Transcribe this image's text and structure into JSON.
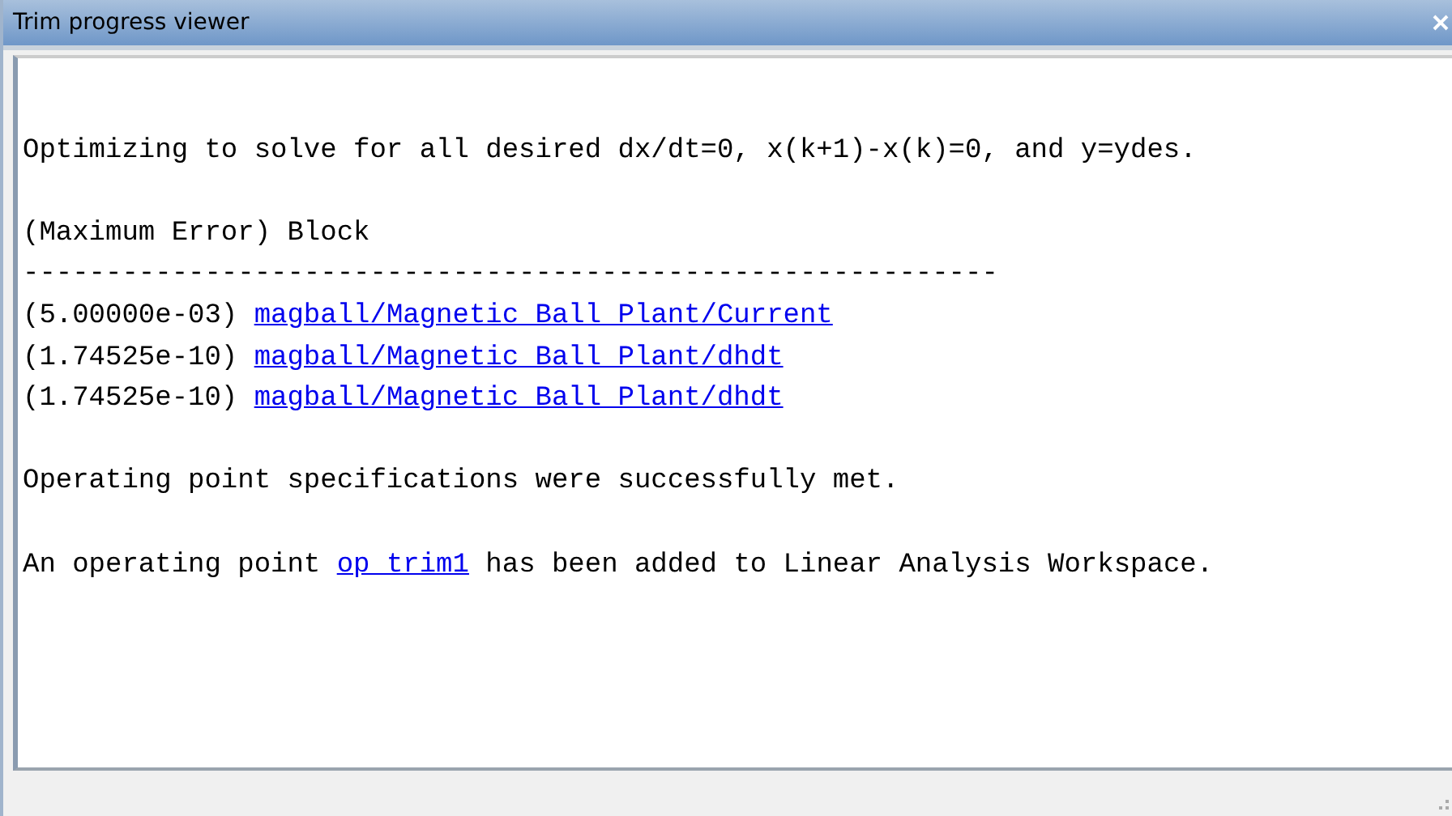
{
  "window": {
    "title": "Trim progress viewer"
  },
  "log": {
    "intro": "Optimizing to solve for all desired dx/dt=0, x(k+1)-x(k)=0, and y=ydes.",
    "table_header": "(Maximum Error) Block",
    "divider": "-----------------------------------------------------------",
    "rows": [
      {
        "error": "(5.00000e-03)",
        "block": "magball/Magnetic Ball Plant/Current"
      },
      {
        "error": "(1.74525e-10)",
        "block": "magball/Magnetic Ball Plant/dhdt"
      },
      {
        "error": "(1.74525e-10)",
        "block": "magball/Magnetic Ball Plant/dhdt"
      }
    ],
    "result": "Operating point specifications were successfully met.",
    "workspace_message": {
      "before": "An operating point",
      "link": "op_trim1",
      "after": "has been added to Linear Analysis Workspace."
    }
  }
}
